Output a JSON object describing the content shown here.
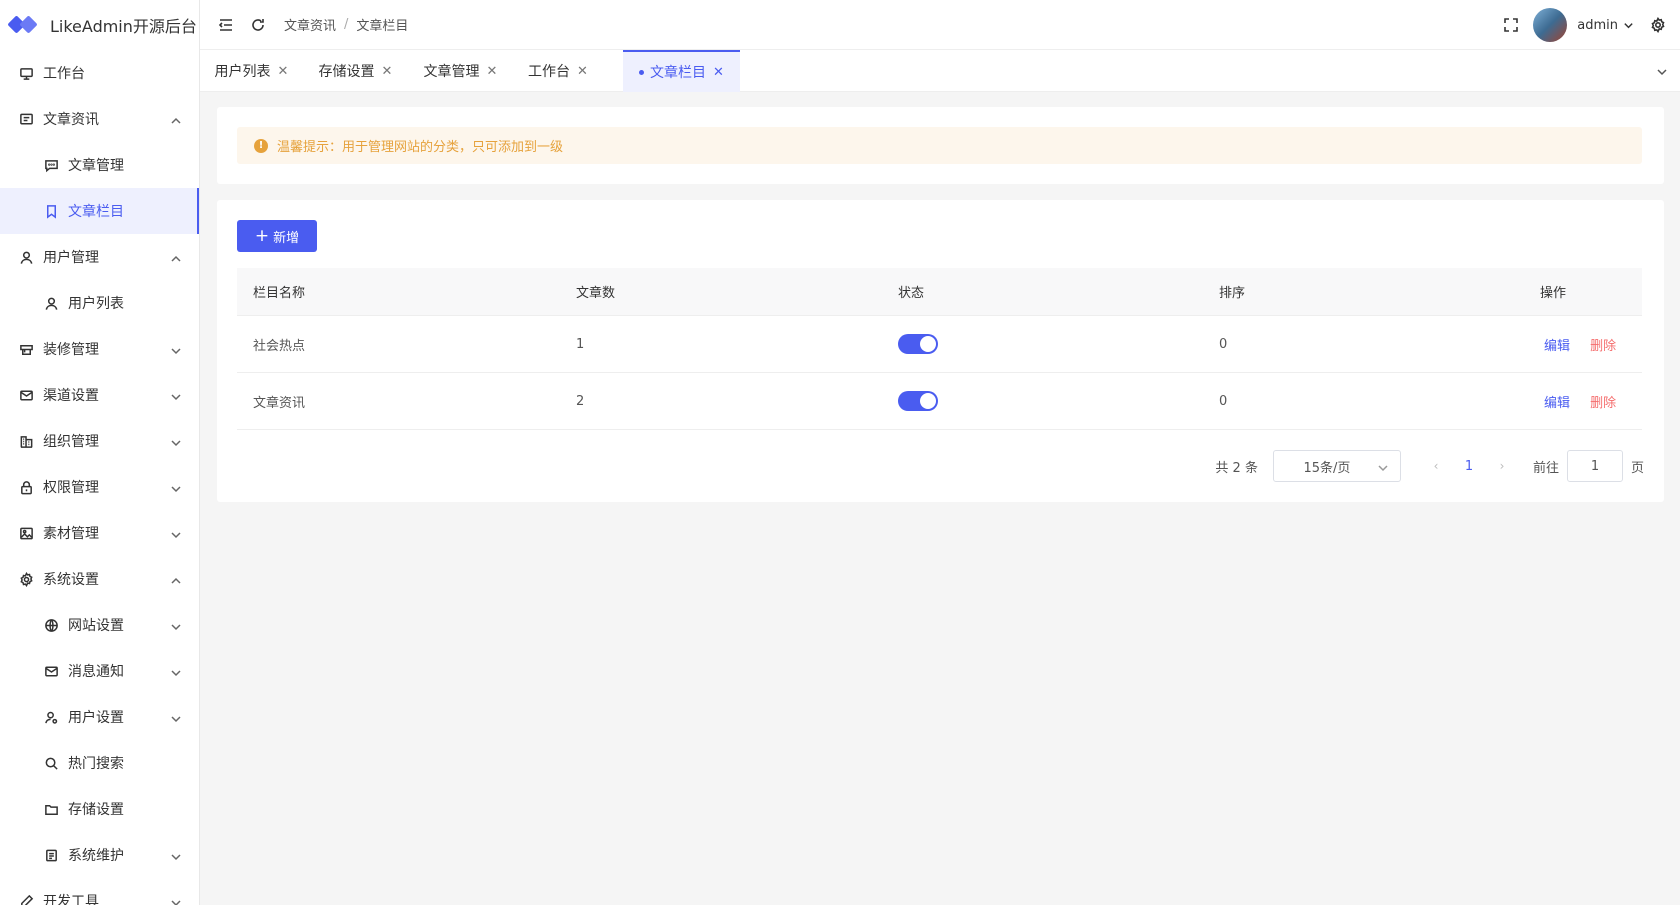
{
  "app": {
    "title": "LikeAdmin开源后台"
  },
  "sidebar": {
    "items": [
      {
        "label": "工作台",
        "icon": "monitor-icon"
      },
      {
        "label": "文章资讯",
        "icon": "message-icon",
        "expanded": true
      },
      {
        "label": "文章管理",
        "icon": "chat-icon",
        "sub": true
      },
      {
        "label": "文章栏目",
        "icon": "bookmark-icon",
        "sub": true,
        "active": true
      },
      {
        "label": "用户管理",
        "icon": "user-icon",
        "expanded": true
      },
      {
        "label": "用户列表",
        "icon": "user-icon",
        "sub": true
      },
      {
        "label": "装修管理",
        "icon": "decorate-icon"
      },
      {
        "label": "渠道设置",
        "icon": "mail-icon"
      },
      {
        "label": "组织管理",
        "icon": "org-icon"
      },
      {
        "label": "权限管理",
        "icon": "lock-icon"
      },
      {
        "label": "素材管理",
        "icon": "image-icon"
      },
      {
        "label": "系统设置",
        "icon": "gear-icon",
        "expanded": true
      },
      {
        "label": "网站设置",
        "icon": "globe-icon",
        "sub": true
      },
      {
        "label": "消息通知",
        "icon": "mail-icon",
        "sub": true
      },
      {
        "label": "用户设置",
        "icon": "user-settings-icon",
        "sub": true
      },
      {
        "label": "热门搜索",
        "icon": "search-icon",
        "sub": true
      },
      {
        "label": "存储设置",
        "icon": "folder-icon",
        "sub": true
      },
      {
        "label": "系统维护",
        "icon": "maintenance-icon",
        "sub": true
      },
      {
        "label": "开发工具",
        "icon": "tool-icon"
      }
    ]
  },
  "header": {
    "breadcrumb": [
      "文章资讯",
      "文章栏目"
    ],
    "username": "admin"
  },
  "tabs": [
    {
      "label": "用户列表"
    },
    {
      "label": "存储设置"
    },
    {
      "label": "文章管理"
    },
    {
      "label": "工作台"
    },
    {
      "label": "文章栏目",
      "active": true
    }
  ],
  "tip": {
    "text": "温馨提示：用于管理网站的分类，只可添加到一级"
  },
  "toolbar": {
    "add_label": "新增"
  },
  "table": {
    "columns": [
      "栏目名称",
      "文章数",
      "状态",
      "排序",
      "操作"
    ],
    "rows": [
      {
        "name": "社会热点",
        "count": "1",
        "enabled": true,
        "sort": "0"
      },
      {
        "name": "文章资讯",
        "count": "2",
        "enabled": true,
        "sort": "0"
      }
    ],
    "actions": {
      "edit": "编辑",
      "delete": "删除"
    }
  },
  "pagination": {
    "total_text": "共 2 条",
    "page_size": "15条/页",
    "current_page": "1",
    "goto_label": "前往",
    "goto_value": "1",
    "page_unit": "页"
  },
  "colors": {
    "primary": "#4a5cf0",
    "danger": "#f56c6c",
    "warning": "#e6a23c"
  }
}
